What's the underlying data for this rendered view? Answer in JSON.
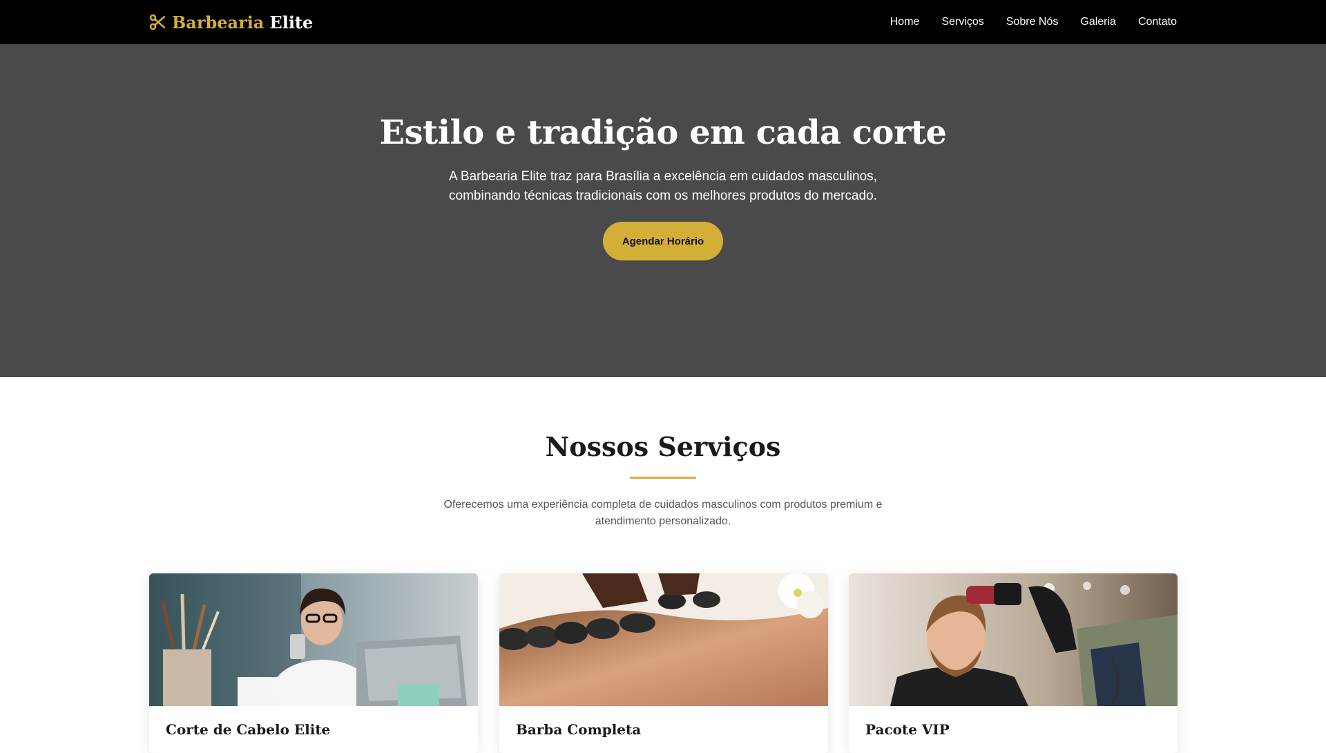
{
  "brand": {
    "part1": "Barbearia",
    "part2": "Elite",
    "icon": "scissors-icon",
    "accent": "#d4af37"
  },
  "nav": {
    "items": [
      "Home",
      "Serviços",
      "Sobre Nós",
      "Galeria",
      "Contato"
    ]
  },
  "hero": {
    "title": "Estilo e tradição em cada corte",
    "line1": "A Barbearia Elite traz para Brasília a excelência em cuidados masculinos,",
    "line2": "combinando técnicas tradicionais com os melhores produtos do mercado.",
    "cta": "Agendar Horário",
    "background": "#4a4a4a"
  },
  "services": {
    "title": "Nossos Serviços",
    "intro1": "Oferecemos uma experiência completa de cuidados masculinos com produtos premium e",
    "intro2": "atendimento personalizado.",
    "cards": [
      {
        "title": "Corte de Cabelo Elite"
      },
      {
        "title": "Barba Completa"
      },
      {
        "title": "Pacote VIP"
      }
    ]
  }
}
